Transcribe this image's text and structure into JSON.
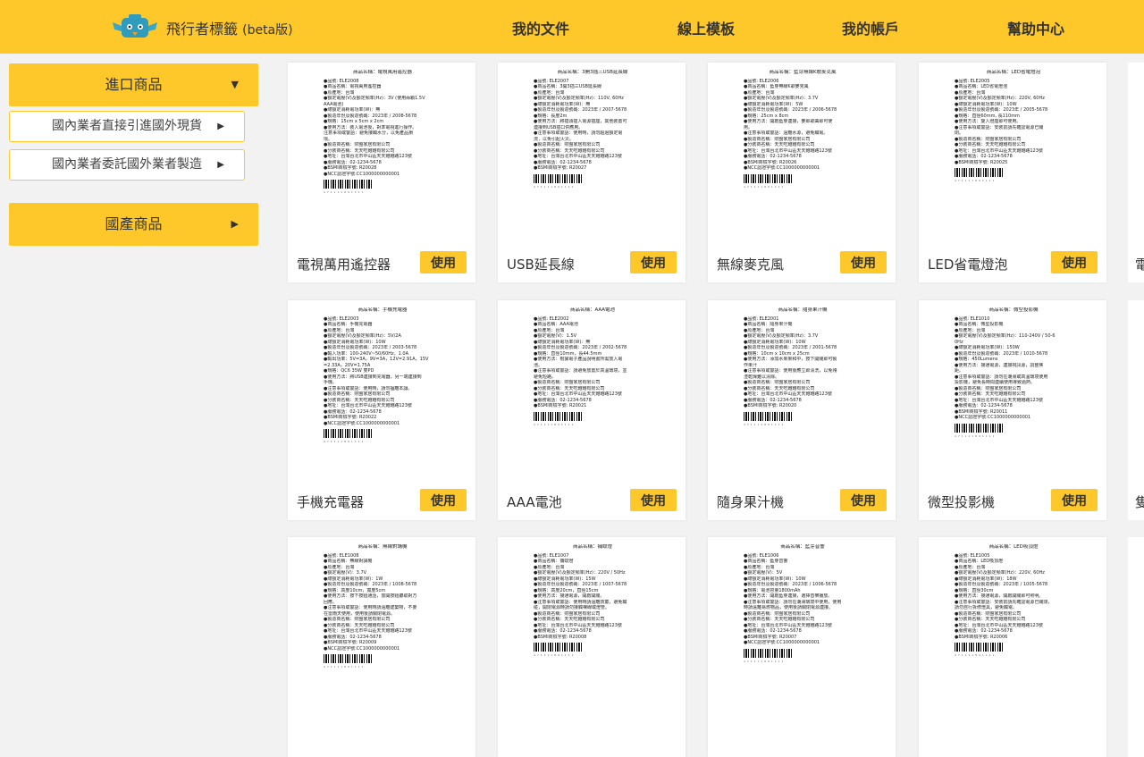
{
  "header": {
    "brand": "飛行者標籤",
    "brand_suffix": "(beta版)",
    "nav": [
      "我的文件",
      "線上模板",
      "我的帳戶",
      "幫助中心"
    ]
  },
  "sidebar": {
    "imported": "進口商品",
    "sub1": "國內業者直接引進國外現貨",
    "sub2": "國內業者委託國外業者製造",
    "domestic": "國產商品"
  },
  "button_label": "使用",
  "partials": [
    "電",
    "隻",
    ""
  ],
  "cards": [
    {
      "name": "電視萬用遙控器",
      "label_title": "商品名稱：電視萬用遙控器",
      "lines": [
        "●品號: ELE2008",
        "●商品名稱：電視萬用遙控器",
        "●原產地：台灣",
        "●額定電壓(V)及額定頻率(Hz)：3V (使用兩顆1.5V",
        "AAA電池)",
        "●總額定消耗電功率(W)：無",
        "●製造年份及製造號碼：2023年 / 2008-5678",
        "●規格：15cm x 5cm x 2cm",
        "●使用方法：裝入電池後，對準電視進行操作。",
        "注意事項或警語：避免接觸水分，以免產品損",
        "壞。",
        "●製造商名稱：財團家居有限公司",
        "●分裝商名稱：天天吃飽飽有限公司",
        "●地址：台灣台北市中山區天天飽飽路123號",
        "●服務電話：02-1234-5678",
        "●BSMI商檢字號: R20028",
        "●NCC認證字號:CC1000000000001"
      ]
    },
    {
      "name": "USB延長線",
      "label_title": "商品名稱：3開3插三USB延長線",
      "lines": [
        "●品號: ELE2007",
        "●商品名稱：3開3插三USB延長線",
        "●原產地：台灣",
        "●額定電壓(V)及額定頻率(Hz)：110V, 60Hz",
        "●總額定消耗電功率(W)：無",
        "●製造年份及製造號碼：2023年 / 2007-5678",
        "●規格：長度2m",
        "●使用方法：將插頭插入電源插座，其他裝置可",
        "連接到USB插口供應用。",
        "●注意事項或警語：使用時，請勿超過額定電",
        "流，以免引起火災。",
        "●製造商名稱：財團家居有限公司",
        "●分裝商名稱：天天吃飽飽有限公司",
        "●地址：台灣台北市中山區天天飽飽路123號",
        "●服務電話：02-1234-5678",
        "●BSMI商檢字號: R20027"
      ]
    },
    {
      "name": "無線麥克風",
      "label_title": "商品名稱：藍芽無線K歌麥克風",
      "lines": [
        "●品號: ELE2006",
        "●商品名稱：藍芽無線K歌麥克風",
        "●原產地：台灣",
        "●額定電壓(V)及額定頻率(Hz)：3.7V",
        "●總額定消耗電功率(W)：5W",
        "●製造年份及製造號碼：2023年 / 2006-5678",
        "●規格：25cm x 8cm",
        "●使用方法：開啟藍芽連接，麥即歌曲即可使",
        "用。",
        "●注意事項或警語：遠離水源，避免觸電。",
        "●製造商名稱：財團家居有限公司",
        "●分裝商名稱：天天吃飽飽有限公司",
        "●地址：台灣台北市中山區天天飽飽路123號",
        "●服務電話：02-1234-5678",
        "●BSMI商檢字號: R20026",
        "●NCC認證字號:CC1000000000001"
      ]
    },
    {
      "name": "LED省電燈泡",
      "label_title": "商品名稱：LED省電燈泡",
      "lines": [
        "●品號: ELE2005",
        "●商品名稱：LED省電燈泡",
        "●原產地：台灣",
        "●額定電壓(V)及額定頻率(Hz)：220V, 60Hz",
        "●總額定消耗電功率(W)：10W",
        "●製造年份及製造號碼：2023年 / 2005-5678",
        "●規格：直徑60mm, 長110mm",
        "●使用方法：旋入燈座即可使用。",
        "●注意事項或警語：安裝前請先確認電源已關",
        "閉。",
        "●製造商名稱：財團家居有限公司",
        "●分裝商名稱：天天吃飽飽有限公司",
        "●地址：台灣台北市中山區天天飽飽路123號",
        "●服務電話：02-1234-5678",
        "●BSMI商檢字號: R20025"
      ]
    },
    {
      "name": "手機充電器",
      "label_title": "商品名稱：手機充電器",
      "lines": [
        "●品號: ELE2003",
        "●商品名稱：手機充電器",
        "●原產地：台灣",
        "●額定電壓(V)及額定頻率(Hz)：5V/2A",
        "●總額定消耗電功率(W)：10W",
        "●製造年份及製造號碼：2023年 / 2003-5678",
        "●輸入功率：100-240V~50/60Hz，1.0A",
        "●輸出功率：5V=3A，9V=3A，12V=2.91A，15V",
        "=2.33A，20V=1.75A",
        "●規格：QC6 35W 雙PD",
        "●使用方法：將USB連接到充電器，另一端連接到",
        "手機。",
        "●注意事項或警語：使用時，請勿擅離本讓。",
        "●製造商名稱：財團家居有限公司",
        "●分裝商名稱：天天吃飽飽有限公司",
        "●地址：台灣台北市中山區天天飽飽路123號",
        "●服務電話：02-1234-5678",
        "●BSMI商檢字號: R20022",
        "●NCC認證字號:CC1000000000001"
      ]
    },
    {
      "name": "AAA電池",
      "label_title": "商品名稱：AAA電池",
      "lines": [
        "●品號: ELE2002",
        "●商品名稱：AAA電池",
        "●原產地：台灣",
        "●額定電壓(V)：1.5V",
        "●總額定消耗電功率(W)：無",
        "●製造年份及製造號碼：2023年 / 2002-5678",
        "●規格：直徑10mm，長44.5mm",
        "●使用方法：根據電子產品說明書所需放入電",
        "池。",
        "●注意事項或警語：請避免放置於高溫環境，並",
        "避免短路。",
        "●製造商名稱：財團家居有限公司",
        "●分裝商名稱：天天吃飽飽有限公司",
        "●地址：台灣台北市中山區天天飽飽路123號",
        "●服務電話：02-1234-5678",
        "●BSMI商檢字號: R20021"
      ]
    },
    {
      "name": "隨身果汁機",
      "label_title": "商品名稱：隨身果汁機",
      "lines": [
        "●品號: ELE2001",
        "●商品名稱：隨身果汁機",
        "●原產地：台灣",
        "●額定電壓(V)及額定頻率(Hz)：3.7V",
        "●總額定消耗電功率(W)：10W",
        "●製造年份及製造號碼：2023年 / 2001-5678",
        "●規格：10cm x 10cm x 25cm",
        "●使用方法：添加水果果和中，按下開關即可製",
        "作果汁",
        "●注意事項或警語：使用後應立即清洗，以免殘",
        "渣乾燥難以清除。",
        "●製造商名稱：財團家居有限公司",
        "●分裝商名稱：天天吃飽飽有限公司",
        "●地址：台灣台北市中山區天天飽飽路123號",
        "●服務電話：02-1234-5678",
        "●BSMI商檢字號: R20020"
      ]
    },
    {
      "name": "微型投影機",
      "label_title": "商品名稱：微型投影機",
      "lines": [
        "●品號: ELE1010",
        "●商品名稱：微型投影機",
        "●原產地：台灣",
        "●額定電壓(V)及額定頻率(Hz)：110-240V / 50-6",
        "0Hz",
        "●總額定消耗電功率(W)：150W",
        "●製造年份及製造號碼：2023年 / 1010-5678",
        "●規格：450Lumens",
        "●使用方法：接通電源，連接視訊源，調整焦",
        "距。",
        "●注意事項或警語：請勿在潮濕或高溫環境使用",
        "投影機，避免長時間連續使用導致過熱。",
        "●製造商名稱：財團家居有限公司",
        "●分裝商名稱：天天吃飽飽有限公司",
        "●地址：台灣台北市中山區天天飽飽路123號",
        "●服務電話：02-1234-5678",
        "●BSMI商檢字號: R20011",
        "●NCC認證字號:CC1000000000001"
      ]
    },
    {
      "name": "",
      "label_title": "商品名稱：無線對講機",
      "lines": [
        "●品號: ELE1008",
        "●商品名稱：無線對講機",
        "●原產地：台灣",
        "●額定電壓(V)：3.7V",
        "●總額定消耗電功率(W)：1W",
        "●製造年份及製造號碼：2023年 / 1008-5678",
        "●規格：高度10cm，寬度5cm",
        "●使用方法：按下按鈕通話，放開按鈕聽取對方",
        "回應。",
        "●注意事項或警語：使用時請遠離建築物，不要",
        "在雷雨天使用，使用後請關閉電源。",
        "●製造商名稱：財團家居有限公司",
        "●分裝商名稱：天天吃飽飽有限公司",
        "●地址：台灣台北市中山區天天飽飽路123號",
        "●服務電話：02-1234-5678",
        "●BSMI商檢字號: R20009",
        "●NCC認證字號:CC1000000000001"
      ]
    },
    {
      "name": "",
      "label_title": "商品名稱：捕蚊燈",
      "lines": [
        "●品號: ELE1007",
        "●商品名稱：捕蚊燈",
        "●原產地：台灣",
        "●額定電壓(V)及額定頻率(Hz)：220V / 50Hz",
        "●總額定消耗電功率(W)：15W",
        "●製造年份及製造號碼：2023年 / 1007-5678",
        "●規格：高度20cm，直徑15cm",
        "●使用方法：接通電源，開啟開關。",
        "●注意事項或警語：使用時請遠離孩童，避免觸",
        "碰，開閉電源時請勿接觸裸線或燈管。",
        "●製造商名稱：財團家居有限公司",
        "●分裝商名稱：天天吃飽飽有限公司",
        "●地址：台灣台北市中山區天天飽飽路123號",
        "●服務電話：02-1234-5678",
        "●BSMI商檢字號: R20008"
      ]
    },
    {
      "name": "",
      "label_title": "商品名稱：藍芽音響",
      "lines": [
        "●品號: ELE1006",
        "●商品名稱：藍芽音響",
        "●原產地：台灣",
        "●額定電壓(V)：5V",
        "●總額定消耗電功率(W)：10W",
        "●製造年份及製造號碼：2023年 / 1006-5678",
        "●規格：電池容量1800mAh",
        "●使用方法：開啟藍芽連接，選擇音樂播放。",
        "●注意事項或警語：請勿在潮濕環境中使用，使用",
        "時請遠離易燃物品，使用後請關閉電源連接。",
        "●製造商名稱：財團家居有限公司",
        "●分裝商名稱：天天吃飽飽有限公司",
        "●地址：台灣台北市中山區天天飽飽路123號",
        "●服務電話：02-1234-5678",
        "●BSMI商檢字號: R20007",
        "●NCC認證字號:CC1000000000001"
      ]
    },
    {
      "name": "",
      "label_title": "商品名稱：LED吸頂燈",
      "lines": [
        "●品號: ELE1005",
        "●商品名稱：LED吸頂燈",
        "●原產地：台灣",
        "●額定電壓(V)及額定頻率(Hz)：220V, 60Hz",
        "●總額定消耗電功率(W)：18W",
        "●製造年份及製造號碼：2023年 / 1005-5678",
        "●規格：直徑30cm",
        "●使用方法：接通電源，開啟開關即可照明。",
        "●注意事項或警語：安裝前請先確認電源已關閉，",
        "請勿自行拆修燈具，避免觸電。",
        "●製造商名稱：財團家居有限公司",
        "●分裝商名稱：天天吃飽飽有限公司",
        "●地址：台灣台北市中山區天天飽飽路123號",
        "●服務電話：02-1234-5678",
        "●BSMI商檢字號: R20006"
      ]
    }
  ]
}
